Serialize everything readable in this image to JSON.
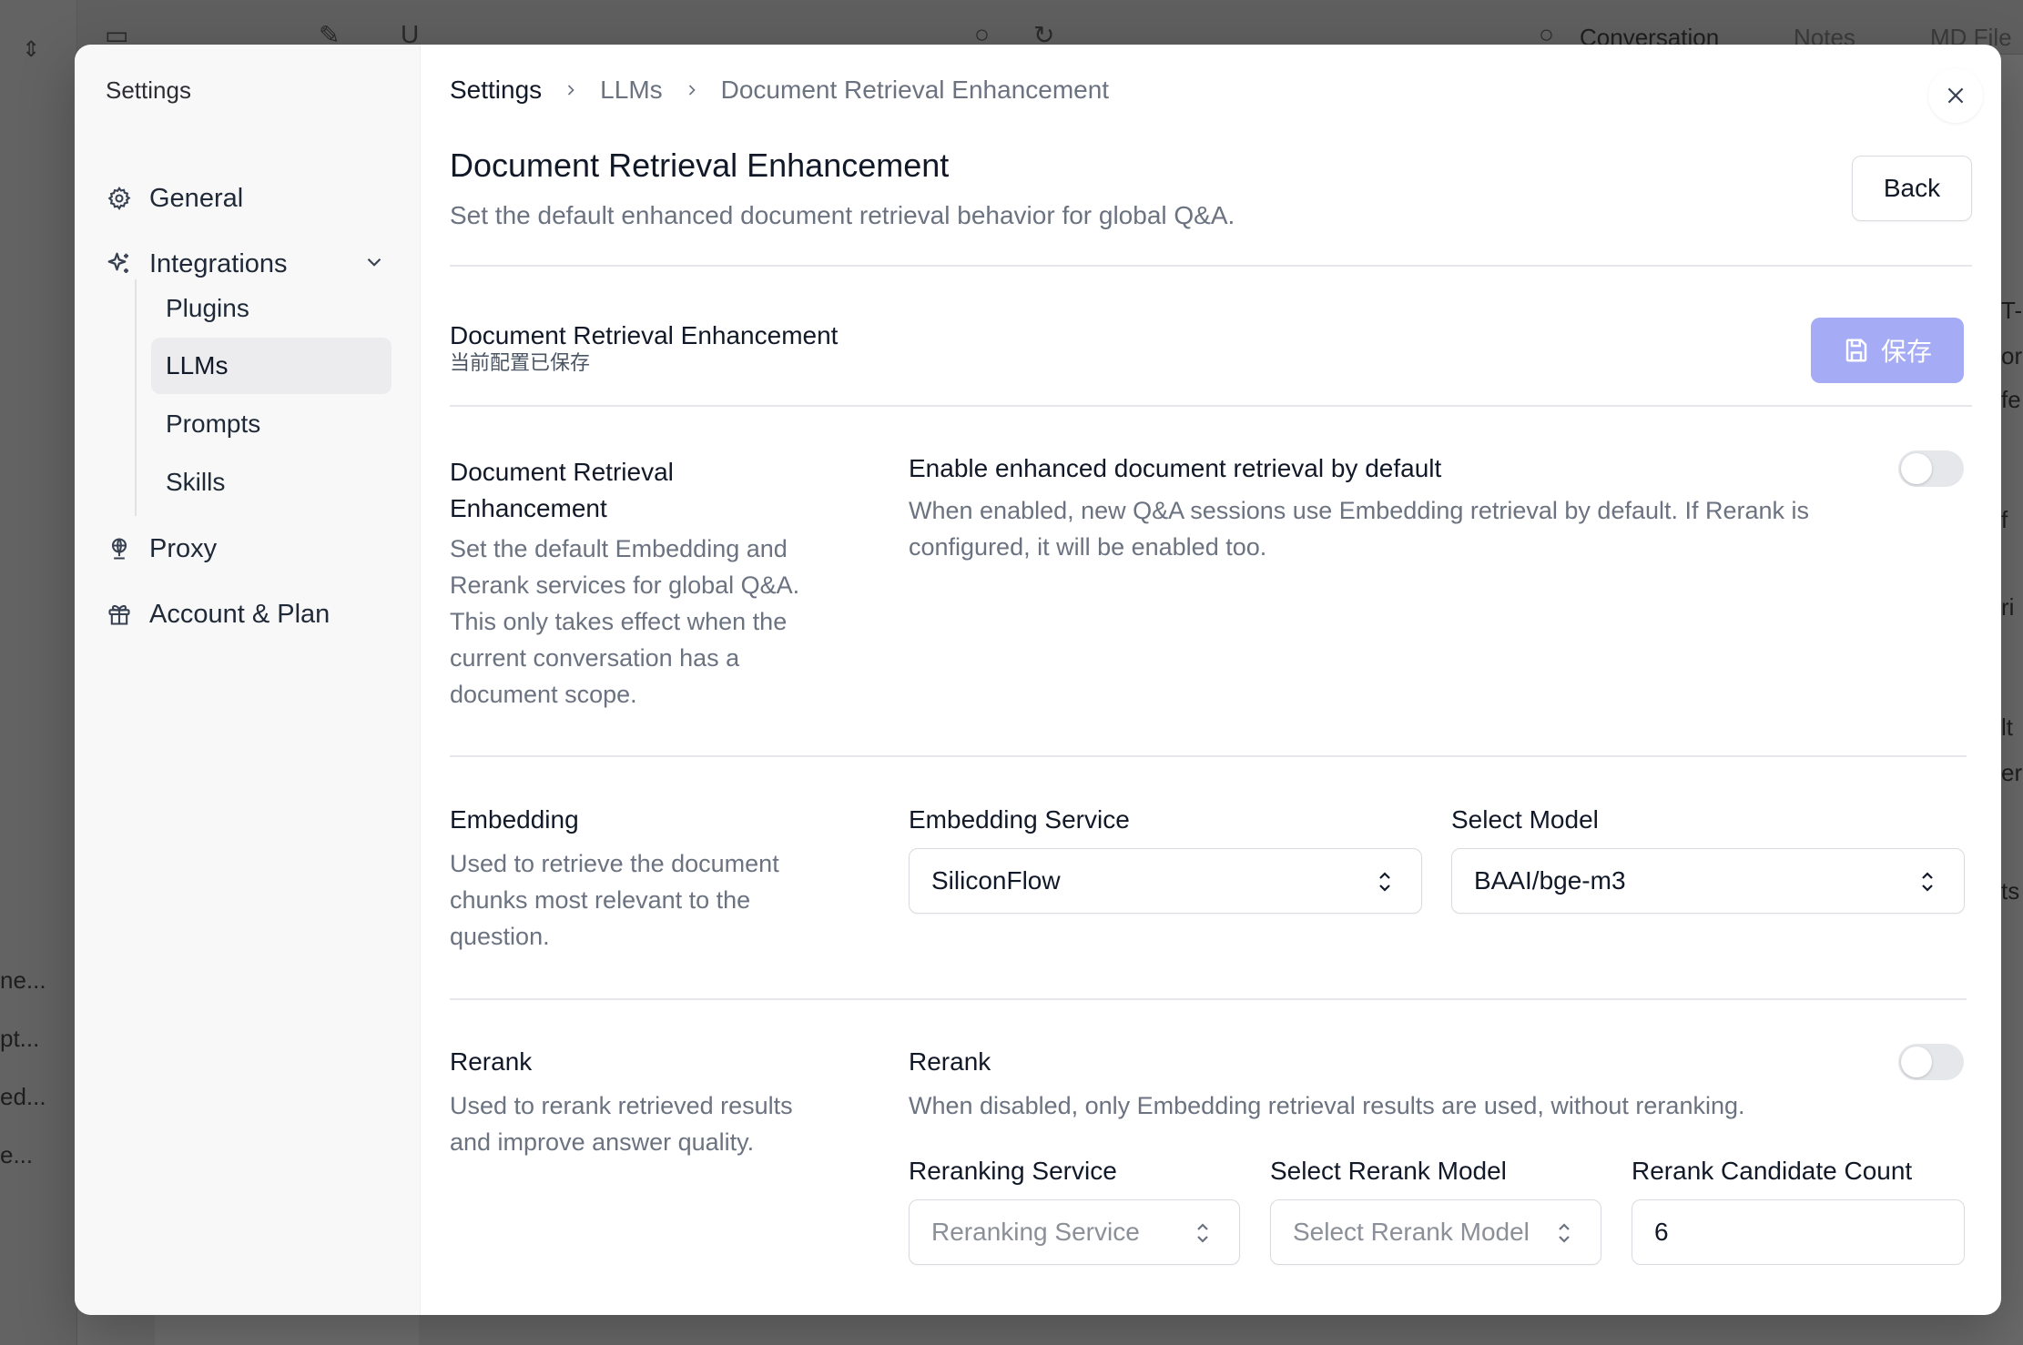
{
  "background": {
    "left_snippets": [
      "ne...",
      "pt...",
      "ed...",
      "e..."
    ],
    "right_snippets": [
      "T-",
      "or",
      "fe",
      "f",
      "ri",
      "lt",
      "er",
      "ts"
    ],
    "toolbar_tabs": [
      "Conversation",
      "Notes",
      "MD File"
    ]
  },
  "sidebar": {
    "title": "Settings",
    "items": {
      "general": "General",
      "integrations": "Integrations",
      "proxy": "Proxy",
      "account": "Account & Plan"
    },
    "sub_items": {
      "plugins": "Plugins",
      "llms": "LLMs",
      "prompts": "Prompts",
      "skills": "Skills"
    }
  },
  "breadcrumb": {
    "c0": "Settings",
    "c1": "LLMs",
    "c2": "Document Retrieval Enhancement"
  },
  "header": {
    "title": "Document Retrieval Enhancement",
    "subtitle": "Set the default enhanced document retrieval behavior for global Q&A.",
    "back_label": "Back"
  },
  "status_bar": {
    "title": "Document Retrieval Enhancement",
    "status": "当前配置已保存",
    "save_label": "保存"
  },
  "section_dre": {
    "title_line1": "Document Retrieval",
    "title_line2": "Enhancement",
    "desc_lines": [
      "Set the default Embedding and",
      "Rerank services for global Q&A.",
      "This only takes effect when the",
      "current conversation has a",
      "document scope."
    ],
    "option_title": "Enable enhanced document retrieval by default",
    "option_desc_lines": [
      "When enabled, new Q&A sessions use Embedding retrieval by default. If Rerank is",
      "configured, it will be enabled too."
    ],
    "enabled": false
  },
  "section_embedding": {
    "title": "Embedding",
    "desc_lines": [
      "Used to retrieve the document",
      "chunks most relevant to the",
      "question."
    ],
    "service_label": "Embedding Service",
    "service_value": "SiliconFlow",
    "model_label": "Select Model",
    "model_value": "BAAI/bge-m3"
  },
  "section_rerank": {
    "title": "Rerank",
    "desc_lines": [
      "Used to rerank retrieved results",
      "and improve answer quality."
    ],
    "option_title": "Rerank",
    "option_desc": "When disabled, only Embedding retrieval results are used, without reranking.",
    "enabled": false,
    "service_label": "Reranking Service",
    "service_placeholder": "Reranking Service",
    "model_label": "Select Rerank Model",
    "model_placeholder": "Select Rerank Model",
    "count_label": "Rerank Candidate Count",
    "count_value": "6"
  }
}
